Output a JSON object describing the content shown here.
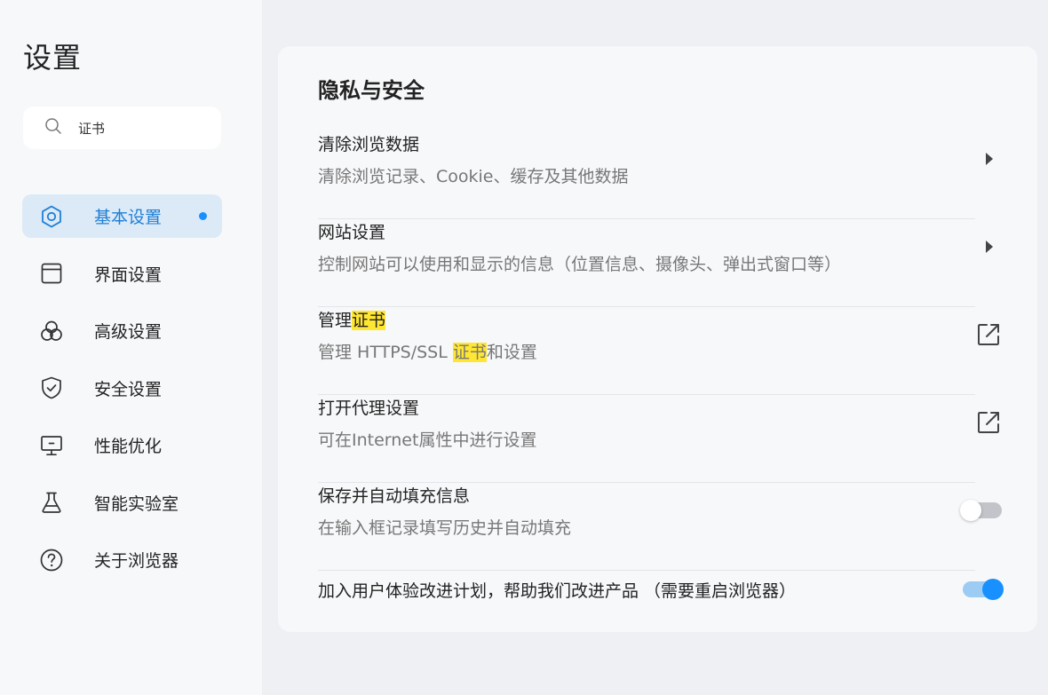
{
  "sidebar": {
    "title": "设置",
    "search": {
      "value": "证书",
      "placeholder": ""
    },
    "items": [
      {
        "label": "基本设置",
        "icon": "hexagon-settings-icon",
        "active": true
      },
      {
        "label": "界面设置",
        "icon": "window-icon",
        "active": false
      },
      {
        "label": "高级设置",
        "icon": "circles-icon",
        "active": false
      },
      {
        "label": "安全设置",
        "icon": "shield-icon",
        "active": false
      },
      {
        "label": "性能优化",
        "icon": "monitor-icon",
        "active": false
      },
      {
        "label": "智能实验室",
        "icon": "flask-icon",
        "active": false
      },
      {
        "label": "关于浏览器",
        "icon": "help-circle-icon",
        "active": false
      }
    ]
  },
  "main": {
    "section_title": "隐私与安全",
    "rows": [
      {
        "title": "清除浏览数据",
        "desc": "清除浏览记录、Cookie、缓存及其他数据",
        "action": "arrow"
      },
      {
        "title": "网站设置",
        "desc": "控制网站可以使用和显示的信息（位置信息、摄像头、弹出式窗口等）",
        "action": "arrow"
      },
      {
        "title_pre": "管理",
        "title_hl": "证书",
        "desc_pre": "管理 HTTPS/SSL ",
        "desc_hl": "证书",
        "desc_post": "和设置",
        "action": "external-link"
      },
      {
        "title": "打开代理设置",
        "desc": "可在Internet属性中进行设置",
        "action": "external-link"
      },
      {
        "title": "保存并自动填充信息",
        "desc": "在输入框记录填写历史并自动填充",
        "action": "toggle",
        "toggle_on": false
      },
      {
        "title": "加入用户体验改进计划，帮助我们改进产品 （需要重启浏览器）",
        "action": "toggle",
        "toggle_on": true
      }
    ]
  },
  "colors": {
    "accent": "#1890ff",
    "highlight": "#ffe632",
    "active_bg": "#dceaf7"
  }
}
